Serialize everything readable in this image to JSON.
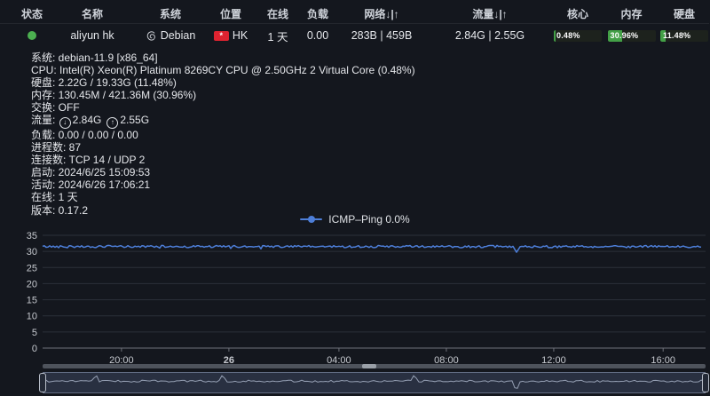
{
  "colors": {
    "background": "#14171e",
    "status_online": "#4caf50",
    "bar_fill": "#43a047",
    "line_blue": "#4d7ed8",
    "flag_red": "#de2330"
  },
  "table": {
    "headers": [
      {
        "label": "状态"
      },
      {
        "label": "名称"
      },
      {
        "label": "系统"
      },
      {
        "label": "位置"
      },
      {
        "label": "在线"
      },
      {
        "label": "负载"
      },
      {
        "label": "网络↓|↑"
      },
      {
        "label": "流量↓|↑"
      },
      {
        "label": "核心"
      },
      {
        "label": "内存"
      },
      {
        "label": "硬盘"
      }
    ],
    "row": {
      "name": "aliyun hk",
      "os": "Debian",
      "location": "HK",
      "flag_glyph": "*",
      "online": "1 天",
      "load": "0.00",
      "network": "283B | 459B",
      "traffic": "2.84G | 2.55G",
      "core_pct": "0.48%",
      "memory_pct": "30.96%",
      "disk_pct": "11.48%",
      "core_val": 0.48,
      "memory_val": 30.96,
      "disk_val": 11.48
    }
  },
  "details": [
    {
      "label": "系统:",
      "value": "debian-11.9 [x86_64]"
    },
    {
      "label": "CPU:",
      "value": "Intel(R) Xeon(R) Platinum 8269CY CPU @ 2.50GHz 2 Virtual Core (0.48%)"
    },
    {
      "label": "硬盘:",
      "value": "2.22G / 19.33G (11.48%)"
    },
    {
      "label": "内存:",
      "value": "130.45M / 421.36M (30.96%)"
    },
    {
      "label": "交换:",
      "value": "OFF"
    },
    {
      "label": "流量:",
      "down": "2.84G",
      "up": "2.55G"
    },
    {
      "label": "负载:",
      "value": "0.00 / 0.00 / 0.00"
    },
    {
      "label": "进程数:",
      "value": "87"
    },
    {
      "label": "连接数:",
      "value": "TCP 14 / UDP 2"
    },
    {
      "label": "启动:",
      "value": "2024/6/25 15:09:53"
    },
    {
      "label": "活动:",
      "value": "2024/6/26 17:06:21"
    },
    {
      "label": "在线:",
      "value": "1 天"
    },
    {
      "label": "版本:",
      "value": "0.17.2"
    }
  ],
  "chart_data": {
    "type": "line",
    "title": "",
    "legend": "ICMP–Ping 0.0%",
    "legend_position": "top-center",
    "grid": true,
    "ylim": [
      0,
      35
    ],
    "yticks": [
      0,
      5,
      10,
      15,
      20,
      25,
      30,
      35
    ],
    "xticks": [
      {
        "label": "20:00",
        "frac": 0.119
      },
      {
        "label": "26",
        "frac": 0.281,
        "emphasis": true
      },
      {
        "label": "04:00",
        "frac": 0.447
      },
      {
        "label": "08:00",
        "frac": 0.609
      },
      {
        "label": "12:00",
        "frac": 0.771
      },
      {
        "label": "16:00",
        "frac": 0.936
      }
    ],
    "series": [
      {
        "name": "ICMP-Ping",
        "baseline": 31.5,
        "noise_amplitude": 0.35,
        "dip": {
          "x_frac": 0.715,
          "value": 29.7
        }
      }
    ],
    "line_color": "#4d7ed8",
    "datazoom": {
      "range": [
        0,
        100
      ],
      "shadow_baseline_frac": 0.42,
      "shadow_spikes_up": [
        0.08,
        0.27,
        0.56
      ],
      "shadow_spike_down": 0.715
    }
  }
}
